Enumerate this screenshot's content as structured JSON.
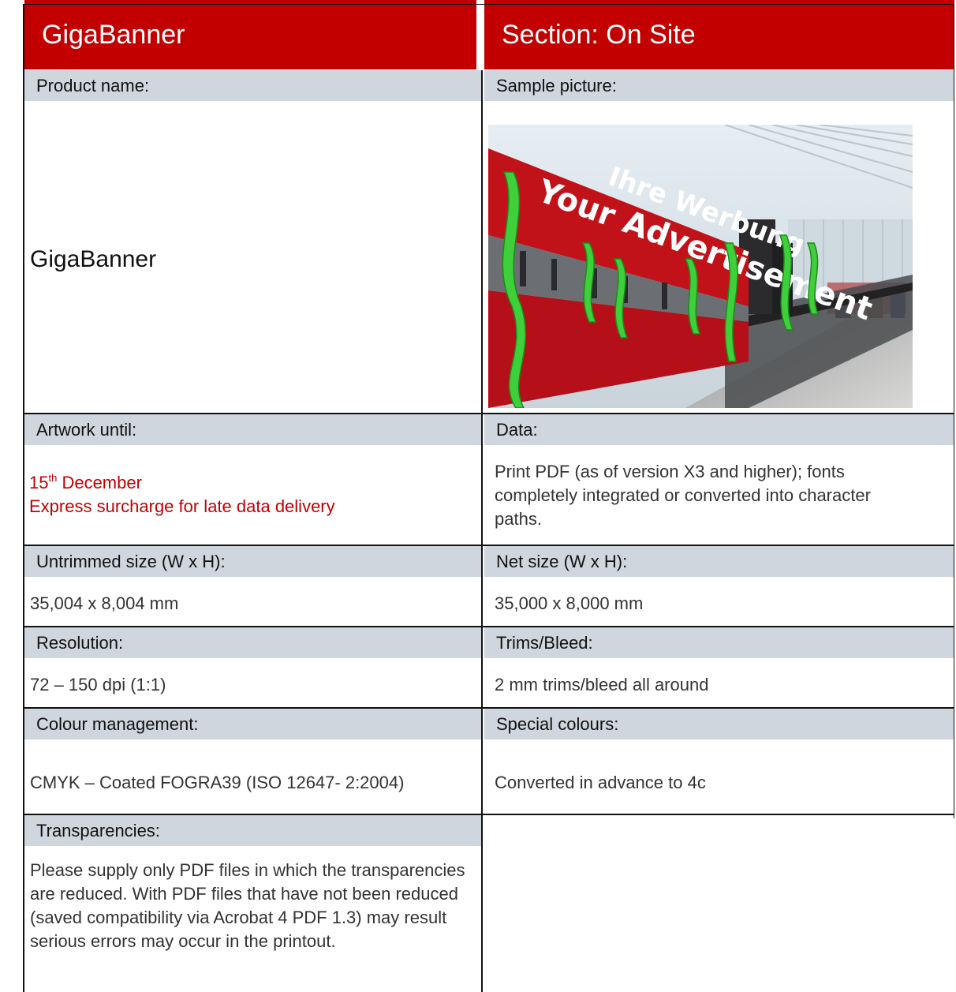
{
  "header": {
    "left_title": "GigaBanner",
    "right_title": "Section: On Site"
  },
  "product": {
    "label": "Product name:",
    "value": "GigaBanner"
  },
  "sample": {
    "label": "Sample picture:",
    "banner_line1": "Ihre Werbung",
    "banner_line2": "Your Advertisement"
  },
  "artwork": {
    "label": "Artwork until:",
    "day": "15",
    "day_suffix": "th",
    "month": " December",
    "note": "Express surcharge for late data delivery"
  },
  "data_field": {
    "label": "Data:",
    "value": "Print PDF (as of version X3 and higher); fonts completely integrated or converted into character paths."
  },
  "untrimmed": {
    "label": "Untrimmed size (W x H):",
    "value": "35,004 x 8,004 mm"
  },
  "net": {
    "label": "Net size (W x H):",
    "value": "35,000 x 8,000 mm"
  },
  "resolution": {
    "label": "Resolution:",
    "value": "72 – 150 dpi (1:1)"
  },
  "trims": {
    "label": "Trims/Bleed:",
    "value": "2 mm trims/bleed all around"
  },
  "colour": {
    "label": "Colour management:",
    "value": "CMYK – Coated FOGRA39 (ISO 12647- 2:2004)"
  },
  "special": {
    "label": "Special colours:",
    "value": "Converted in advance to 4c"
  },
  "transparencies": {
    "label": "Transparencies:",
    "value": "Please supply only PDF files in which the transparencies are reduced. With PDF files that have not been reduced (saved compatibility via Acrobat 4 PDF 1.3) may result serious errors may occur in the printout."
  },
  "colors": {
    "title_red": "#c30000",
    "label_gray": "#cfd6dd",
    "accent_red_text": "#c00000"
  }
}
